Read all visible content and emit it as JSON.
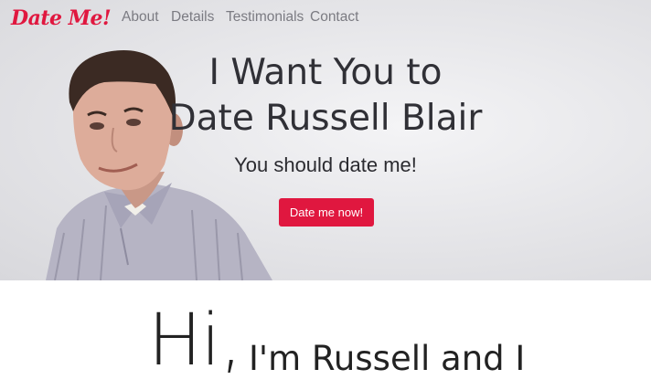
{
  "nav": {
    "brand": "Date Me!",
    "links": [
      "About",
      "Details",
      "Testimonials",
      "Contact"
    ]
  },
  "hero": {
    "headline_line1": "I Want You to",
    "headline_line2": "Date Russell Blair",
    "subhead": "You should date me!",
    "cta_label": "Date me now!"
  },
  "intro": {
    "hi": "Hi,",
    "rest": "I'm Russell and I"
  },
  "colors": {
    "accent": "#e0173f",
    "nav_text": "#7b7b82",
    "headline": "#303036"
  }
}
